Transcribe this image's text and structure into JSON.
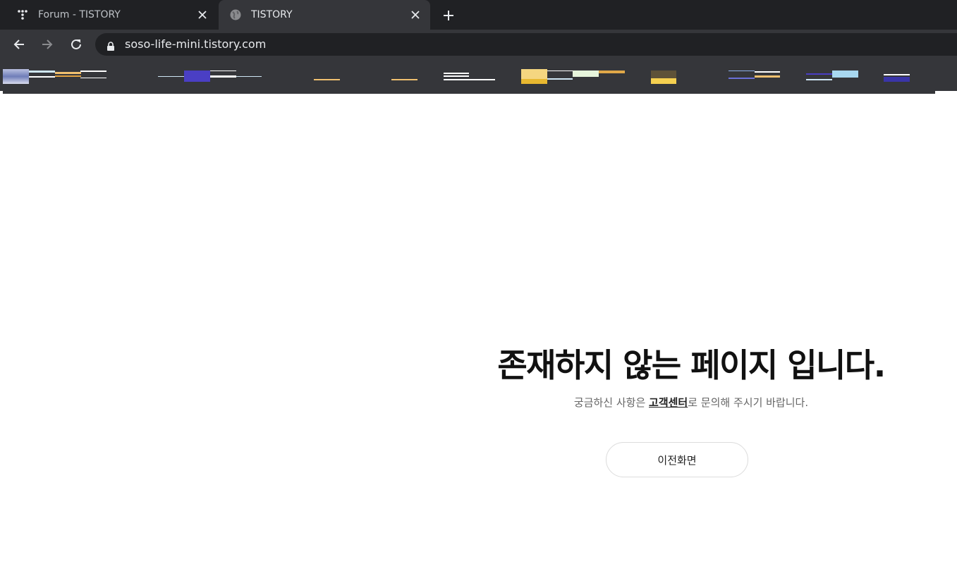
{
  "browser": {
    "tabs": [
      {
        "title": "Forum - TISTORY",
        "active": false,
        "icon": "tistory-logo-icon"
      },
      {
        "title": "TISTORY",
        "active": true,
        "icon": "globe-icon"
      }
    ],
    "url": "soso-life-mini.tistory.com",
    "colors": {
      "tabstrip": "#202124",
      "toolbar": "#35363a",
      "omnibox": "#202124",
      "text": "#e8eaed"
    }
  },
  "page": {
    "heading": "존재하지 않는 페이지 입니다.",
    "description_before": "궁금하신 사항은 ",
    "description_link": "고객센터",
    "description_after": "로 문의해 주시기 바랍니다.",
    "back_button": "이전화면"
  }
}
